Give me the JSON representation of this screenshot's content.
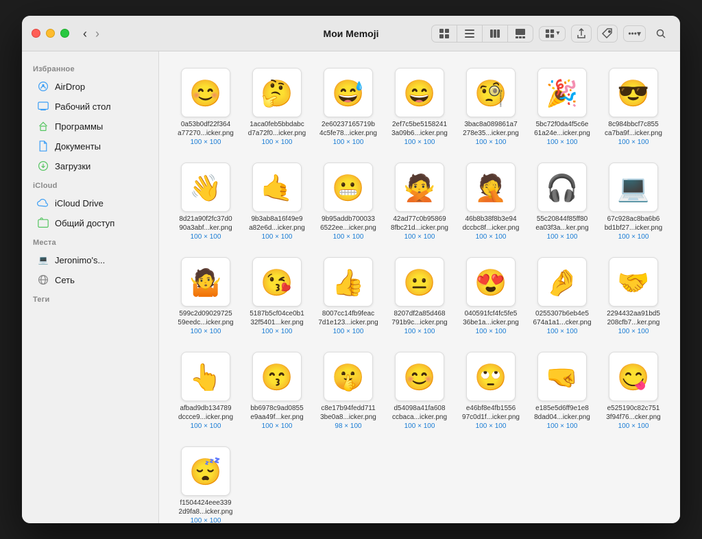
{
  "window": {
    "title": "Мои Memoji"
  },
  "toolbar": {
    "back_label": "‹",
    "forward_label": "›",
    "view_grid_label": "⊞",
    "view_list_label": "☰",
    "view_column_label": "⊟",
    "view_gallery_label": "⊡",
    "view_dropdown_label": "⊞▾",
    "share_label": "⬆",
    "tag_label": "◇",
    "more_label": "•••",
    "search_label": "⌕"
  },
  "sidebar": {
    "favorites_label": "Избранное",
    "icloud_label": "iCloud",
    "places_label": "Места",
    "tags_label": "Теги",
    "items": [
      {
        "id": "airdrop",
        "label": "AirDrop",
        "icon": "airdrop"
      },
      {
        "id": "desktop",
        "label": "Рабочий стол",
        "icon": "desktop"
      },
      {
        "id": "programs",
        "label": "Программы",
        "icon": "programs"
      },
      {
        "id": "documents",
        "label": "Документы",
        "icon": "documents"
      },
      {
        "id": "downloads",
        "label": "Загрузки",
        "icon": "downloads"
      },
      {
        "id": "icloud-drive",
        "label": "iCloud Drive",
        "icon": "icloud"
      },
      {
        "id": "shared",
        "label": "Общий доступ",
        "icon": "shared"
      },
      {
        "id": "jeronimos",
        "label": "Jeronimo's...",
        "icon": "computer"
      },
      {
        "id": "network",
        "label": "Сеть",
        "icon": "network"
      }
    ]
  },
  "files": [
    {
      "name": "0a53b0df22f364\na77270...icker.png",
      "size": "100 × 100",
      "emoji": "😊"
    },
    {
      "name": "1aca0feb5bbdabc\nd7a72f0...icker.png",
      "size": "100 × 100",
      "emoji": "🤔"
    },
    {
      "name": "2e60237165719b\n4c5fe78...icker.png",
      "size": "100 × 100",
      "emoji": "😅"
    },
    {
      "name": "2ef7c5be5158241\n3a09b6...icker.png",
      "size": "100 × 100",
      "emoji": "😄"
    },
    {
      "name": "3bac8a089861a7\n278e35...icker.png",
      "size": "100 × 100",
      "emoji": "🧐"
    },
    {
      "name": "5bc72f0da4f5c6e\n61a24e...icker.png",
      "size": "100 × 100",
      "emoji": "🎉"
    },
    {
      "name": "8c984bbcf7c855\nca7ba9f...icker.png",
      "size": "100 × 100",
      "emoji": "😎"
    },
    {
      "name": "8d21a90f2fc37d0\n90a3abf...ker.png",
      "size": "100 × 100",
      "emoji": "👋"
    },
    {
      "name": "9b3ab8a16f49e9\na82e6d...icker.png",
      "size": "100 × 100",
      "emoji": "🤙"
    },
    {
      "name": "9b95addb700033\n6522ee...icker.png",
      "size": "100 × 100",
      "emoji": "😬"
    },
    {
      "name": "42ad77c0b95869\n8fbc21d...icker.png",
      "size": "100 × 100",
      "emoji": "🙅"
    },
    {
      "name": "46b8b38f8b3e94\ndccbc8f...icker.png",
      "size": "100 × 100",
      "emoji": "🤦"
    },
    {
      "name": "55c20844f85ff80\nea03f3a...ker.png",
      "size": "100 × 100",
      "emoji": "🎧"
    },
    {
      "name": "67c928ac8ba6b6\nbd1bf27...icker.png",
      "size": "100 × 100",
      "emoji": "💻"
    },
    {
      "name": "599c2d09029725\n59eedc...icker.png",
      "size": "100 × 100",
      "emoji": "🤷"
    },
    {
      "name": "5187b5cf04ce0b1\n32f5401...ker.png",
      "size": "100 × 100",
      "emoji": "😘"
    },
    {
      "name": "8007cc14fb9feac\n7d1e123...icker.png",
      "size": "100 × 100",
      "emoji": "👍"
    },
    {
      "name": "8207df2a85d468\n791b9c...icker.png",
      "size": "100 × 100",
      "emoji": "😐"
    },
    {
      "name": "040591fcf4fc5fe5\n36be1a...icker.png",
      "size": "100 × 100",
      "emoji": "😍"
    },
    {
      "name": "0255307b6eb4e5\n674a1a1...cker.png",
      "size": "100 × 100",
      "emoji": "🤌"
    },
    {
      "name": "2294432aa91bd5\n208cfb7...ker.png",
      "size": "100 × 100",
      "emoji": "🤝"
    },
    {
      "name": "afbad9db134789\ndccce9...icker.png",
      "size": "100 × 100",
      "emoji": "👆"
    },
    {
      "name": "bb6978c9ad0855\ne9aa49f...ker.png",
      "size": "100 × 100",
      "emoji": "😙"
    },
    {
      "name": "c8e17b94fedd711\n3be0a8...icker.png",
      "size": "98 × 100",
      "emoji": "🤫"
    },
    {
      "name": "d54098a41fa608\nccbaca...icker.png",
      "size": "100 × 100",
      "emoji": "😊"
    },
    {
      "name": "e46bf8e4fb1556\n97c0d1f...icker.png",
      "size": "100 × 100",
      "emoji": "🙄"
    },
    {
      "name": "e185e5d6ff9e1e8\n8dad04...icker.png",
      "size": "100 × 100",
      "emoji": "🤜"
    },
    {
      "name": "e525190c82c751\n3f94f76...cker.png",
      "size": "100 × 100",
      "emoji": "😋"
    },
    {
      "name": "f1504424eee339\n2d9fa8...icker.png",
      "size": "100 × 100",
      "emoji": "😴"
    }
  ],
  "colors": {
    "accent": "#1a7cd4",
    "sidebar_bg": "#f0f0f0",
    "content_bg": "#f5f5f5",
    "tl_close": "#ff5f57",
    "tl_min": "#febc2e",
    "tl_max": "#28c840"
  }
}
